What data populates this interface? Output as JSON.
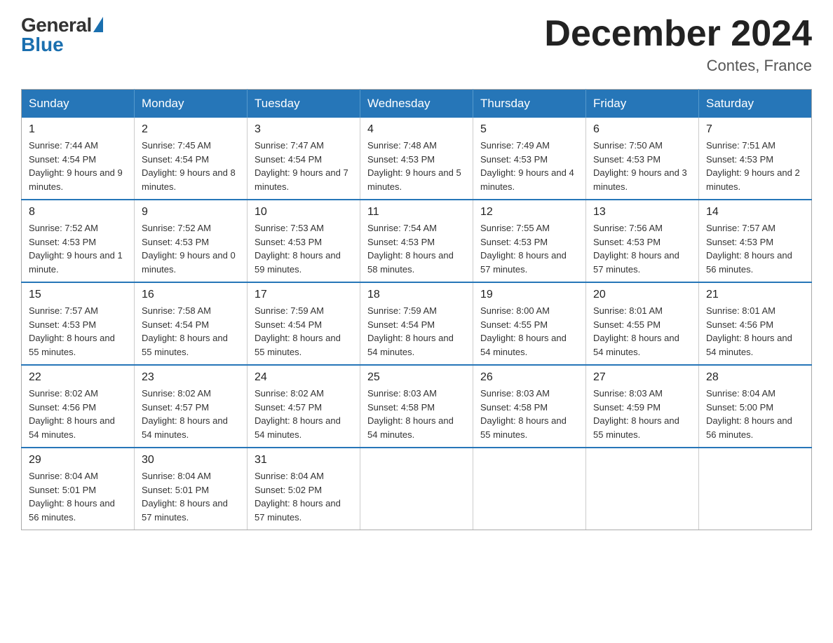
{
  "logo": {
    "general": "General",
    "blue": "Blue"
  },
  "header": {
    "title": "December 2024",
    "location": "Contes, France"
  },
  "weekdays": [
    "Sunday",
    "Monday",
    "Tuesday",
    "Wednesday",
    "Thursday",
    "Friday",
    "Saturday"
  ],
  "weeks": [
    [
      {
        "day": "1",
        "sunrise": "7:44 AM",
        "sunset": "4:54 PM",
        "daylight": "9 hours and 9 minutes."
      },
      {
        "day": "2",
        "sunrise": "7:45 AM",
        "sunset": "4:54 PM",
        "daylight": "9 hours and 8 minutes."
      },
      {
        "day": "3",
        "sunrise": "7:47 AM",
        "sunset": "4:54 PM",
        "daylight": "9 hours and 7 minutes."
      },
      {
        "day": "4",
        "sunrise": "7:48 AM",
        "sunset": "4:53 PM",
        "daylight": "9 hours and 5 minutes."
      },
      {
        "day": "5",
        "sunrise": "7:49 AM",
        "sunset": "4:53 PM",
        "daylight": "9 hours and 4 minutes."
      },
      {
        "day": "6",
        "sunrise": "7:50 AM",
        "sunset": "4:53 PM",
        "daylight": "9 hours and 3 minutes."
      },
      {
        "day": "7",
        "sunrise": "7:51 AM",
        "sunset": "4:53 PM",
        "daylight": "9 hours and 2 minutes."
      }
    ],
    [
      {
        "day": "8",
        "sunrise": "7:52 AM",
        "sunset": "4:53 PM",
        "daylight": "9 hours and 1 minute."
      },
      {
        "day": "9",
        "sunrise": "7:52 AM",
        "sunset": "4:53 PM",
        "daylight": "9 hours and 0 minutes."
      },
      {
        "day": "10",
        "sunrise": "7:53 AM",
        "sunset": "4:53 PM",
        "daylight": "8 hours and 59 minutes."
      },
      {
        "day": "11",
        "sunrise": "7:54 AM",
        "sunset": "4:53 PM",
        "daylight": "8 hours and 58 minutes."
      },
      {
        "day": "12",
        "sunrise": "7:55 AM",
        "sunset": "4:53 PM",
        "daylight": "8 hours and 57 minutes."
      },
      {
        "day": "13",
        "sunrise": "7:56 AM",
        "sunset": "4:53 PM",
        "daylight": "8 hours and 57 minutes."
      },
      {
        "day": "14",
        "sunrise": "7:57 AM",
        "sunset": "4:53 PM",
        "daylight": "8 hours and 56 minutes."
      }
    ],
    [
      {
        "day": "15",
        "sunrise": "7:57 AM",
        "sunset": "4:53 PM",
        "daylight": "8 hours and 55 minutes."
      },
      {
        "day": "16",
        "sunrise": "7:58 AM",
        "sunset": "4:54 PM",
        "daylight": "8 hours and 55 minutes."
      },
      {
        "day": "17",
        "sunrise": "7:59 AM",
        "sunset": "4:54 PM",
        "daylight": "8 hours and 55 minutes."
      },
      {
        "day": "18",
        "sunrise": "7:59 AM",
        "sunset": "4:54 PM",
        "daylight": "8 hours and 54 minutes."
      },
      {
        "day": "19",
        "sunrise": "8:00 AM",
        "sunset": "4:55 PM",
        "daylight": "8 hours and 54 minutes."
      },
      {
        "day": "20",
        "sunrise": "8:01 AM",
        "sunset": "4:55 PM",
        "daylight": "8 hours and 54 minutes."
      },
      {
        "day": "21",
        "sunrise": "8:01 AM",
        "sunset": "4:56 PM",
        "daylight": "8 hours and 54 minutes."
      }
    ],
    [
      {
        "day": "22",
        "sunrise": "8:02 AM",
        "sunset": "4:56 PM",
        "daylight": "8 hours and 54 minutes."
      },
      {
        "day": "23",
        "sunrise": "8:02 AM",
        "sunset": "4:57 PM",
        "daylight": "8 hours and 54 minutes."
      },
      {
        "day": "24",
        "sunrise": "8:02 AM",
        "sunset": "4:57 PM",
        "daylight": "8 hours and 54 minutes."
      },
      {
        "day": "25",
        "sunrise": "8:03 AM",
        "sunset": "4:58 PM",
        "daylight": "8 hours and 54 minutes."
      },
      {
        "day": "26",
        "sunrise": "8:03 AM",
        "sunset": "4:58 PM",
        "daylight": "8 hours and 55 minutes."
      },
      {
        "day": "27",
        "sunrise": "8:03 AM",
        "sunset": "4:59 PM",
        "daylight": "8 hours and 55 minutes."
      },
      {
        "day": "28",
        "sunrise": "8:04 AM",
        "sunset": "5:00 PM",
        "daylight": "8 hours and 56 minutes."
      }
    ],
    [
      {
        "day": "29",
        "sunrise": "8:04 AM",
        "sunset": "5:01 PM",
        "daylight": "8 hours and 56 minutes."
      },
      {
        "day": "30",
        "sunrise": "8:04 AM",
        "sunset": "5:01 PM",
        "daylight": "8 hours and 57 minutes."
      },
      {
        "day": "31",
        "sunrise": "8:04 AM",
        "sunset": "5:02 PM",
        "daylight": "8 hours and 57 minutes."
      },
      null,
      null,
      null,
      null
    ]
  ],
  "labels": {
    "sunrise": "Sunrise:",
    "sunset": "Sunset:",
    "daylight": "Daylight:"
  }
}
